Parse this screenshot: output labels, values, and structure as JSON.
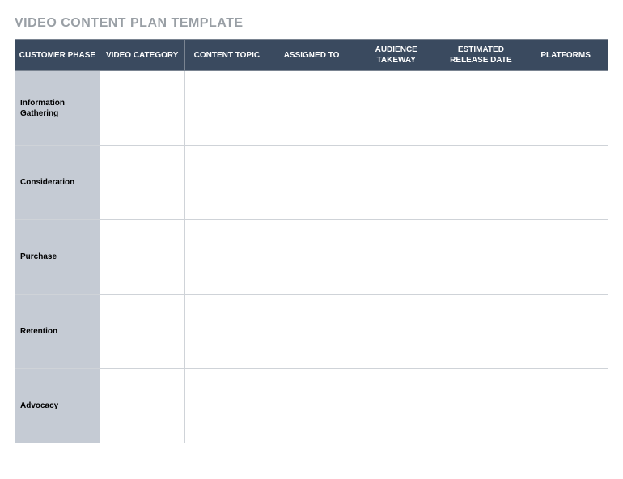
{
  "title": "VIDEO CONTENT PLAN TEMPLATE",
  "columns": [
    "CUSTOMER PHASE",
    "VIDEO CATEGORY",
    "CONTENT TOPIC",
    "ASSIGNED TO",
    "AUDIENCE TAKEWAY",
    "ESTIMATED RELEASE DATE",
    "PLATFORMS"
  ],
  "rows": [
    {
      "phase": "Information Gathering",
      "video_category": "",
      "content_topic": "",
      "assigned_to": "",
      "audience_takeway": "",
      "estimated_release_date": "",
      "platforms": ""
    },
    {
      "phase": "Consideration",
      "video_category": "",
      "content_topic": "",
      "assigned_to": "",
      "audience_takeway": "",
      "estimated_release_date": "",
      "platforms": ""
    },
    {
      "phase": "Purchase",
      "video_category": "",
      "content_topic": "",
      "assigned_to": "",
      "audience_takeway": "",
      "estimated_release_date": "",
      "platforms": ""
    },
    {
      "phase": "Retention",
      "video_category": "",
      "content_topic": "",
      "assigned_to": "",
      "audience_takeway": "",
      "estimated_release_date": "",
      "platforms": ""
    },
    {
      "phase": "Advocacy",
      "video_category": "",
      "content_topic": "",
      "assigned_to": "",
      "audience_takeway": "",
      "estimated_release_date": "",
      "platforms": ""
    }
  ]
}
